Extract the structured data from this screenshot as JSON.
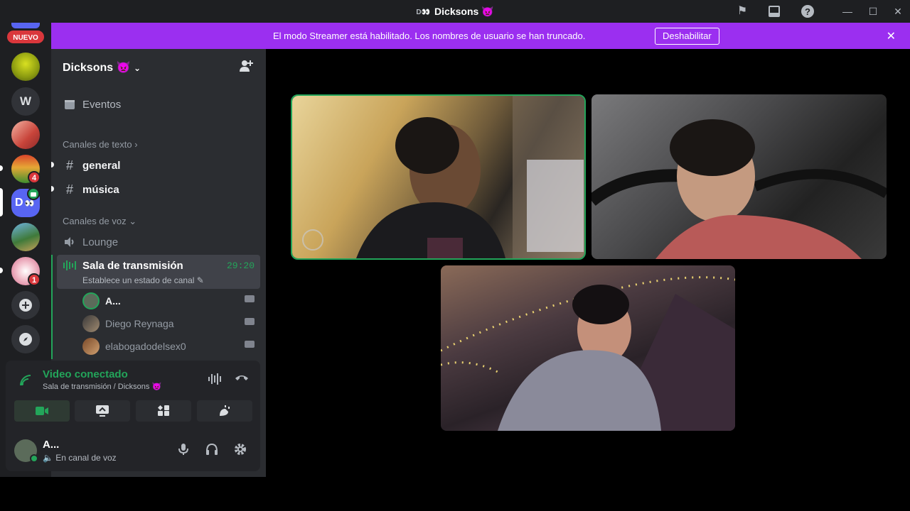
{
  "window": {
    "title_prefix": "D👀",
    "title": "Dicksons 👿",
    "icons": [
      "inbox-flag-icon",
      "inbox-icon",
      "help-icon"
    ],
    "controls": [
      "minimize",
      "maximize",
      "close"
    ]
  },
  "banner": {
    "message": "El modo Streamer está habilitado. Los nombres de usuario se han truncado.",
    "button": "Deshabilitar",
    "color": "#9b2ff0"
  },
  "guilds": {
    "new_badge": "NUEVO",
    "letter_server": "W",
    "badges": [
      "4",
      "1"
    ],
    "active_server_initial": "D"
  },
  "server": {
    "name": "Dicksons 👿",
    "events_label": "Eventos",
    "text_category": "Canales de texto",
    "text_channels": [
      "general",
      "música"
    ],
    "voice_category": "Canales de voz",
    "voice_channels": [
      "Lounge"
    ],
    "active_voice": {
      "name": "Sala de transmisión",
      "status": "Establece un estado de canal",
      "timer": "29:20",
      "users": [
        "A...",
        "Diego Reynaga",
        "elabogadodelsex0"
      ]
    }
  },
  "voice_panel": {
    "title": "Video conectado",
    "subtitle": "Sala de transmisión / Dicksons 👿"
  },
  "user_panel": {
    "name": "A...",
    "status": "En canal de voz"
  },
  "colors": {
    "accent_green": "#23a55a",
    "danger_red": "#da373c"
  }
}
